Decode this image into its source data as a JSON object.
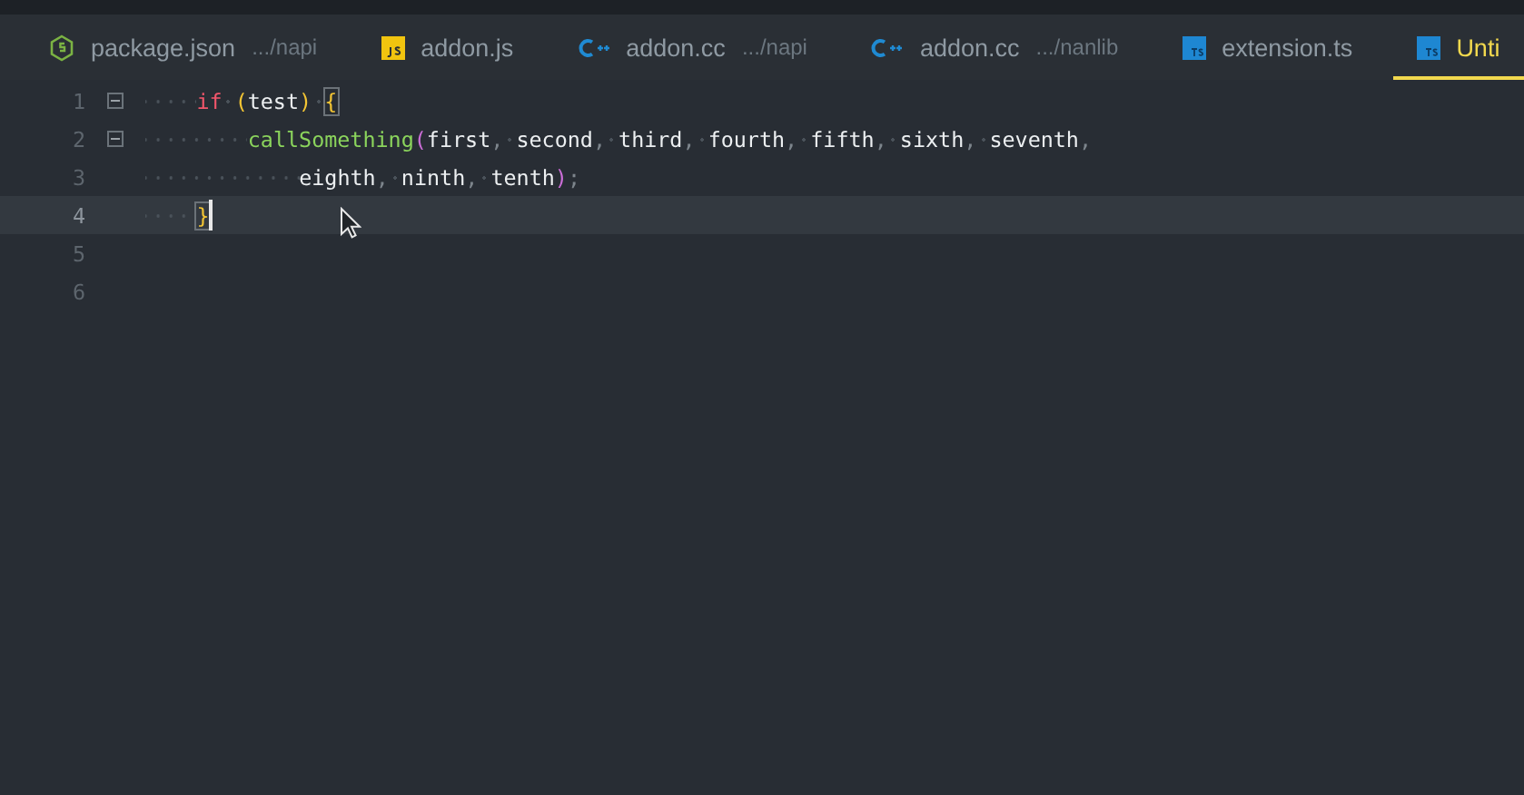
{
  "tabs": [
    {
      "kind": "node",
      "label": "package.json",
      "path": ".../napi",
      "selected": false
    },
    {
      "kind": "js",
      "label": "addon.js",
      "selected": false
    },
    {
      "kind": "cpp",
      "label": "addon.cc",
      "path": ".../napi",
      "selected": false
    },
    {
      "kind": "cpp",
      "label": "addon.cc",
      "path": ".../nanlib",
      "selected": false
    },
    {
      "kind": "ts",
      "label": "extension.ts",
      "selected": false
    },
    {
      "kind": "ts",
      "label": "Unti",
      "selected": true
    }
  ],
  "editor": {
    "lines": [
      {
        "number": "1",
        "foldable": true,
        "current": false,
        "cursor": false,
        "tokens": [
          {
            "kind": "keyword",
            "text": "if"
          },
          {
            "kind": "paren",
            "text": "(",
            "space_before": true
          },
          {
            "kind": "ident",
            "text": "test"
          },
          {
            "kind": "paren",
            "text": ")"
          },
          {
            "kind": "brace",
            "text": "{",
            "matched": true,
            "space_before": true
          }
        ],
        "children": [
          {
            "number": "2",
            "foldable": true,
            "current": false,
            "cursor": false,
            "tokens": [
              {
                "kind": "func",
                "text": "callSomething"
              },
              {
                "kind": "call",
                "text": "("
              },
              {
                "kind": "ident",
                "text": "first"
              },
              {
                "kind": "punct",
                "text": ","
              },
              {
                "kind": "ident",
                "text": "second",
                "space_before": true
              },
              {
                "kind": "punct",
                "text": ","
              },
              {
                "kind": "ident",
                "text": "third",
                "space_before": true
              },
              {
                "kind": "punct",
                "text": ","
              },
              {
                "kind": "ident",
                "text": "fourth",
                "space_before": true
              },
              {
                "kind": "punct",
                "text": ","
              },
              {
                "kind": "ident",
                "text": "fifth",
                "space_before": true
              },
              {
                "kind": "punct",
                "text": ","
              },
              {
                "kind": "ident",
                "text": "sixth",
                "space_before": true
              },
              {
                "kind": "punct",
                "text": ","
              },
              {
                "kind": "ident",
                "text": "seventh",
                "space_before": true
              },
              {
                "kind": "punct",
                "text": ","
              }
            ],
            "children": [
              {
                "number": "3",
                "foldable": false,
                "current": false,
                "cursor": false,
                "tokens": [
                  {
                    "kind": "ident",
                    "text": "eighth"
                  },
                  {
                    "kind": "punct",
                    "text": ","
                  },
                  {
                    "kind": "ident",
                    "text": "ninth",
                    "space_before": true
                  },
                  {
                    "kind": "punct",
                    "text": ","
                  },
                  {
                    "kind": "ident",
                    "text": "tenth",
                    "space_before": true
                  },
                  {
                    "kind": "call",
                    "text": ")"
                  },
                  {
                    "kind": "punct",
                    "text": ";"
                  }
                ]
              }
            ]
          }
        ]
      },
      {
        "number": "4",
        "foldable": false,
        "current": true,
        "cursor": true,
        "tokens": [
          {
            "kind": "brace",
            "text": "}",
            "matched": true
          }
        ]
      },
      {
        "number": "5",
        "foldable": false,
        "current": false,
        "cursor": false
      },
      {
        "number": "6",
        "foldable": false,
        "current": false,
        "cursor": false
      }
    ]
  }
}
